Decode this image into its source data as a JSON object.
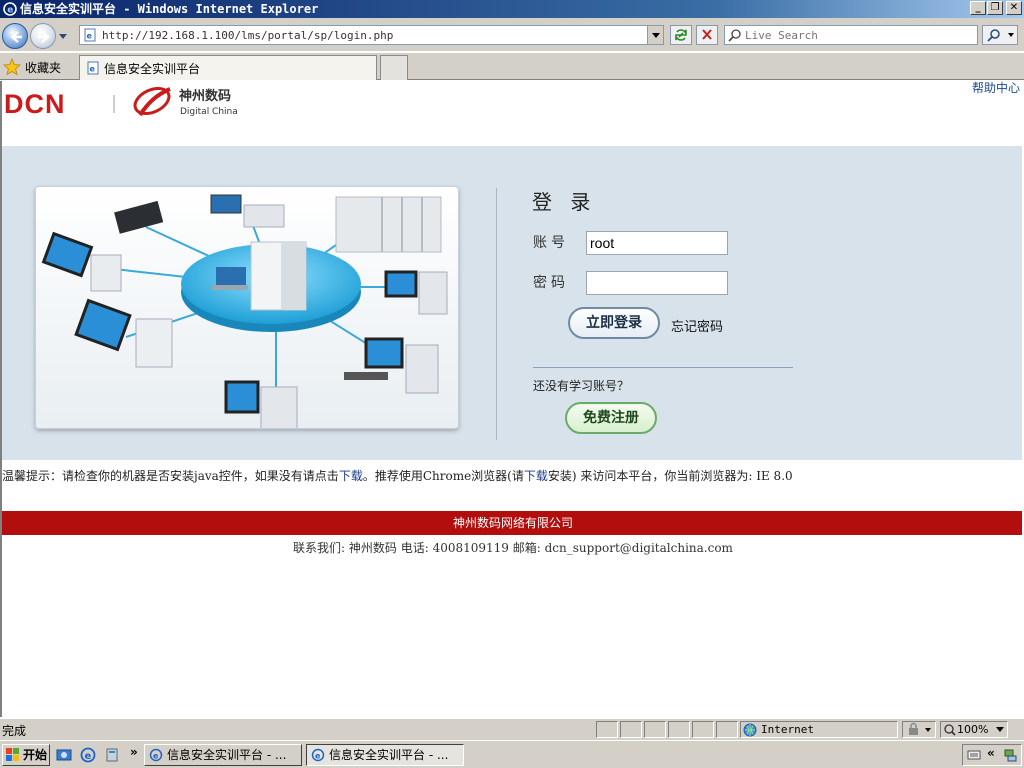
{
  "window": {
    "title": "信息安全实训平台 - Windows Internet Explorer",
    "controls": [
      "_",
      "❐",
      "✕"
    ]
  },
  "addressbar": {
    "url": "http://192.168.1.100/lms/portal/sp/login.php",
    "search_placeholder": "Live Search"
  },
  "favorites": {
    "label": "收藏夹",
    "tab_label": "信息安全实训平台"
  },
  "page": {
    "brand": {
      "dcn": "DCN",
      "company_cn": "神州数码",
      "company_en": "Digital China"
    },
    "help_link": "帮助中心",
    "login": {
      "title": "登 录",
      "account_label": "账号",
      "account_value": "root",
      "password_label": "密码",
      "password_value": "",
      "submit_label": "立即登录",
      "forgot_label": "忘记密码",
      "no_account_text": "还没有学习账号？",
      "register_label": "免费注册"
    },
    "notice": {
      "part1": "温馨提示：请检查你的机器是否安装java控件，如果没有请点击",
      "download1": "下载",
      "part2": "。推荐使用Chrome浏览器(请",
      "download2": "下载",
      "part3": "安装) 来访问本平台，你当前浏览器为: IE 8.0"
    },
    "footer": {
      "company": "神州数码网络有限公司",
      "contact": "联系我们: 神州数码  电话: 4008109119 邮箱: dcn_support@digitalchina.com"
    }
  },
  "statusbar": {
    "status": "完成",
    "zone": "Internet",
    "zoom": "100%"
  },
  "taskbar": {
    "start_label": "开始",
    "chevron": "»",
    "tasks": [
      "信息安全实训平台 - ...",
      "信息安全实训平台 - ..."
    ]
  },
  "colors": {
    "band": "#d7e2ea",
    "footer_red": "#b30e0e",
    "brand_red": "#cc1b1b",
    "title_blue": "#0a246a"
  }
}
